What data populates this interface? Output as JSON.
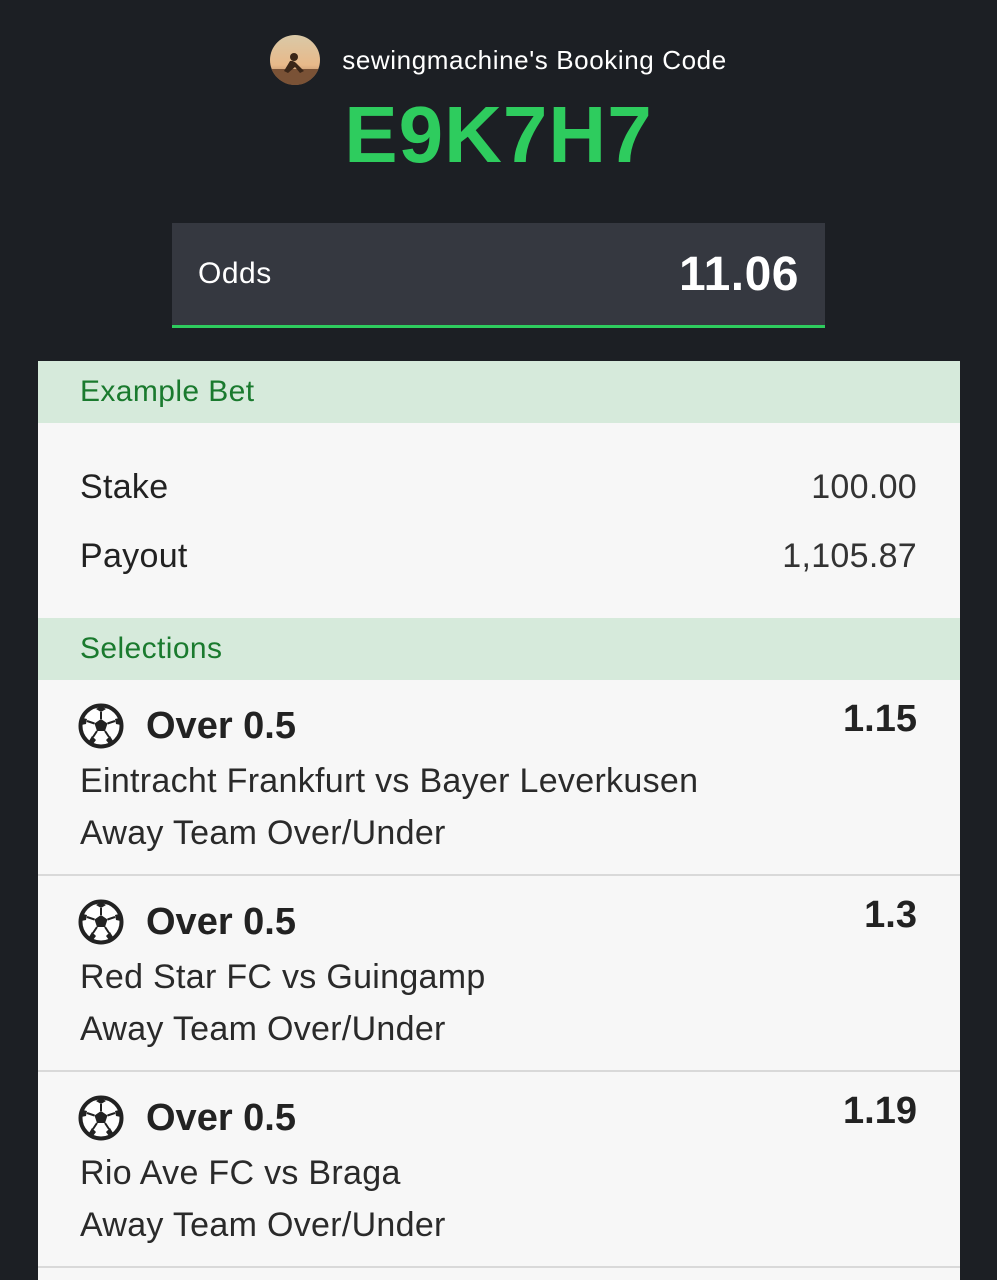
{
  "header": {
    "title": "sewingmachine's Booking Code",
    "code": "E9K7H7",
    "avatar_icon": "user-avatar-icon"
  },
  "odds": {
    "label": "Odds",
    "value": "11.06"
  },
  "example_bet": {
    "heading": "Example Bet",
    "stake_label": "Stake",
    "stake_value": "100.00",
    "payout_label": "Payout",
    "payout_value": "1,105.87"
  },
  "selections": {
    "heading": "Selections",
    "items": [
      {
        "market": "Over 0.5",
        "odds": "1.15",
        "match": "Eintracht Frankfurt vs Bayer Leverkusen",
        "bet_type": "Away Team Over/Under",
        "icon": "soccer-ball-icon"
      },
      {
        "market": "Over 0.5",
        "odds": "1.3",
        "match": "Red Star FC vs Guingamp",
        "bet_type": "Away Team Over/Under",
        "icon": "soccer-ball-icon"
      },
      {
        "market": "Over 0.5",
        "odds": "1.19",
        "match": "Rio Ave FC vs Braga",
        "bet_type": "Away Team Over/Under",
        "icon": "soccer-ball-icon"
      }
    ]
  },
  "colors": {
    "background": "#1c1f24",
    "accent_green": "#2ecc5e",
    "section_header_bg": "#d6eadb",
    "section_header_text": "#1a7a2e",
    "odds_box_bg": "#353840",
    "card_bg": "#f7f7f7"
  }
}
